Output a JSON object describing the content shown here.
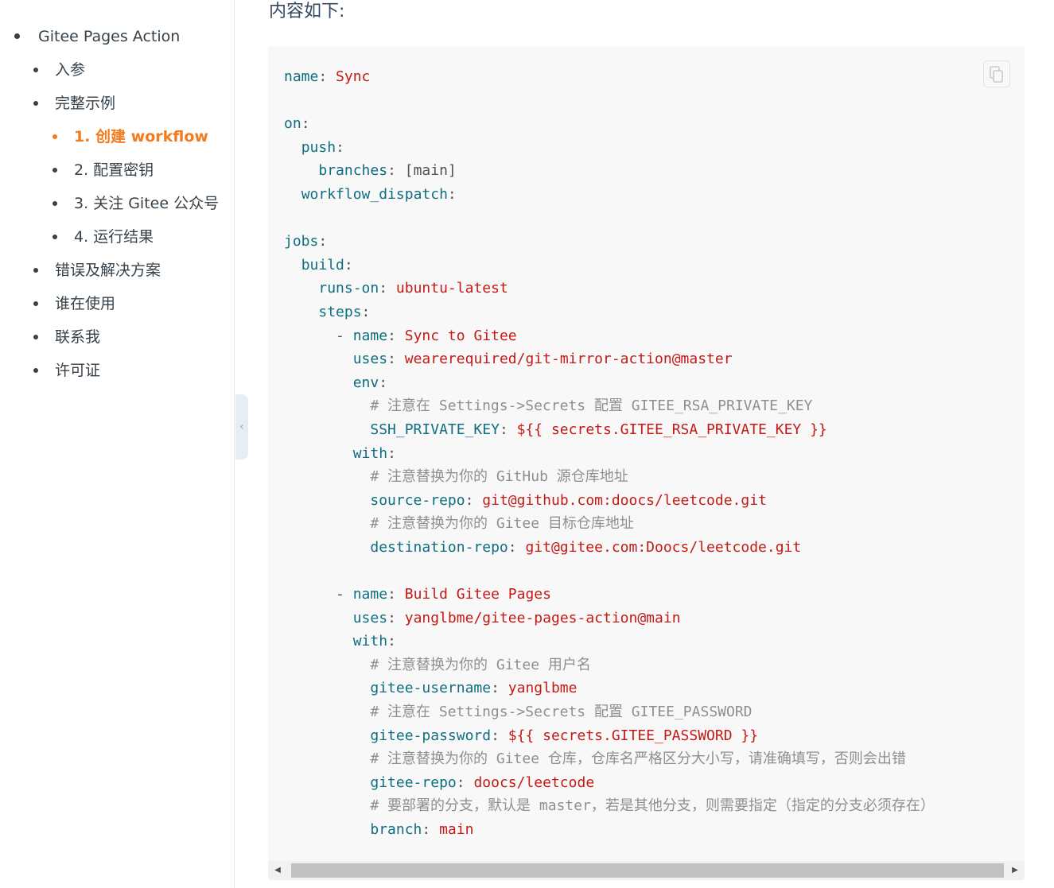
{
  "toc": [
    {
      "label": "Gitee Pages Action",
      "level": 0,
      "active": false
    },
    {
      "label": "入参",
      "level": 1,
      "active": false
    },
    {
      "label": "完整示例",
      "level": 1,
      "active": false
    },
    {
      "label": "1. 创建 workflow",
      "level": 2,
      "active": true
    },
    {
      "label": "2. 配置密钥",
      "level": 2,
      "active": false
    },
    {
      "label": "3. 关注 Gitee 公众号",
      "level": 2,
      "active": false
    },
    {
      "label": "4. 运行结果",
      "level": 2,
      "active": false
    },
    {
      "label": "错误及解决方案",
      "level": 1,
      "active": false
    },
    {
      "label": "谁在使用",
      "level": 1,
      "active": false
    },
    {
      "label": "联系我",
      "level": 1,
      "active": false
    },
    {
      "label": "许可证",
      "level": 1,
      "active": false
    }
  ],
  "sidebar_toggle_icon": "chevron-left-icon",
  "content": {
    "heading": "内容如下:",
    "copy_icon": "copy-icon",
    "code_lines": [
      [
        [
          "k",
          "name"
        ],
        [
          "p",
          ": "
        ],
        [
          "v",
          "Sync"
        ]
      ],
      [],
      [
        [
          "k",
          "on"
        ],
        [
          "p",
          ":"
        ]
      ],
      [
        [
          "p",
          "  "
        ],
        [
          "k",
          "push"
        ],
        [
          "p",
          ":"
        ]
      ],
      [
        [
          "p",
          "    "
        ],
        [
          "k",
          "branches"
        ],
        [
          "p",
          ": [main]"
        ]
      ],
      [
        [
          "p",
          "  "
        ],
        [
          "k",
          "workflow_dispatch"
        ],
        [
          "p",
          ":"
        ]
      ],
      [],
      [
        [
          "k",
          "jobs"
        ],
        [
          "p",
          ":"
        ]
      ],
      [
        [
          "p",
          "  "
        ],
        [
          "k",
          "build"
        ],
        [
          "p",
          ":"
        ]
      ],
      [
        [
          "p",
          "    "
        ],
        [
          "k",
          "runs-on"
        ],
        [
          "p",
          ": "
        ],
        [
          "v",
          "ubuntu-latest"
        ]
      ],
      [
        [
          "p",
          "    "
        ],
        [
          "k",
          "steps"
        ],
        [
          "p",
          ":"
        ]
      ],
      [
        [
          "p",
          "      - "
        ],
        [
          "k",
          "name"
        ],
        [
          "p",
          ": "
        ],
        [
          "v",
          "Sync to Gitee"
        ]
      ],
      [
        [
          "p",
          "        "
        ],
        [
          "k",
          "uses"
        ],
        [
          "p",
          ": "
        ],
        [
          "v",
          "wearerequired/git-mirror-action@master"
        ]
      ],
      [
        [
          "p",
          "        "
        ],
        [
          "k",
          "env"
        ],
        [
          "p",
          ":"
        ]
      ],
      [
        [
          "p",
          "          "
        ],
        [
          "c",
          "# 注意在 Settings->Secrets 配置 GITEE_RSA_PRIVATE_KEY"
        ]
      ],
      [
        [
          "p",
          "          "
        ],
        [
          "k",
          "SSH_PRIVATE_KEY"
        ],
        [
          "p",
          ": "
        ],
        [
          "v",
          "${{ secrets.GITEE_RSA_PRIVATE_KEY }}"
        ]
      ],
      [
        [
          "p",
          "        "
        ],
        [
          "k",
          "with"
        ],
        [
          "p",
          ":"
        ]
      ],
      [
        [
          "p",
          "          "
        ],
        [
          "c",
          "# 注意替换为你的 GitHub 源仓库地址"
        ]
      ],
      [
        [
          "p",
          "          "
        ],
        [
          "k",
          "source-repo"
        ],
        [
          "p",
          ": "
        ],
        [
          "v",
          "git@github.com:doocs/leetcode.git"
        ]
      ],
      [
        [
          "p",
          "          "
        ],
        [
          "c",
          "# 注意替换为你的 Gitee 目标仓库地址"
        ]
      ],
      [
        [
          "p",
          "          "
        ],
        [
          "k",
          "destination-repo"
        ],
        [
          "p",
          ": "
        ],
        [
          "v",
          "git@gitee.com:Doocs/leetcode.git"
        ]
      ],
      [],
      [
        [
          "p",
          "      - "
        ],
        [
          "k",
          "name"
        ],
        [
          "p",
          ": "
        ],
        [
          "v",
          "Build Gitee Pages"
        ]
      ],
      [
        [
          "p",
          "        "
        ],
        [
          "k",
          "uses"
        ],
        [
          "p",
          ": "
        ],
        [
          "v",
          "yanglbme/gitee-pages-action@main"
        ]
      ],
      [
        [
          "p",
          "        "
        ],
        [
          "k",
          "with"
        ],
        [
          "p",
          ":"
        ]
      ],
      [
        [
          "p",
          "          "
        ],
        [
          "c",
          "# 注意替换为你的 Gitee 用户名"
        ]
      ],
      [
        [
          "p",
          "          "
        ],
        [
          "k",
          "gitee-username"
        ],
        [
          "p",
          ": "
        ],
        [
          "v",
          "yanglbme"
        ]
      ],
      [
        [
          "p",
          "          "
        ],
        [
          "c",
          "# 注意在 Settings->Secrets 配置 GITEE_PASSWORD"
        ]
      ],
      [
        [
          "p",
          "          "
        ],
        [
          "k",
          "gitee-password"
        ],
        [
          "p",
          ": "
        ],
        [
          "v",
          "${{ secrets.GITEE_PASSWORD }}"
        ]
      ],
      [
        [
          "p",
          "          "
        ],
        [
          "c",
          "# 注意替换为你的 Gitee 仓库，仓库名严格区分大小写，请准确填写，否则会出错"
        ]
      ],
      [
        [
          "p",
          "          "
        ],
        [
          "k",
          "gitee-repo"
        ],
        [
          "p",
          ": "
        ],
        [
          "v",
          "doocs/leetcode"
        ]
      ],
      [
        [
          "p",
          "          "
        ],
        [
          "c",
          "# 要部署的分支，默认是 master，若是其他分支，则需要指定（指定的分支必须存在）"
        ]
      ],
      [
        [
          "p",
          "          "
        ],
        [
          "k",
          "branch"
        ],
        [
          "p",
          ": "
        ],
        [
          "v",
          "main"
        ]
      ]
    ]
  },
  "scrollbar": {
    "left_arrow": "◀",
    "right_arrow": "▶"
  }
}
